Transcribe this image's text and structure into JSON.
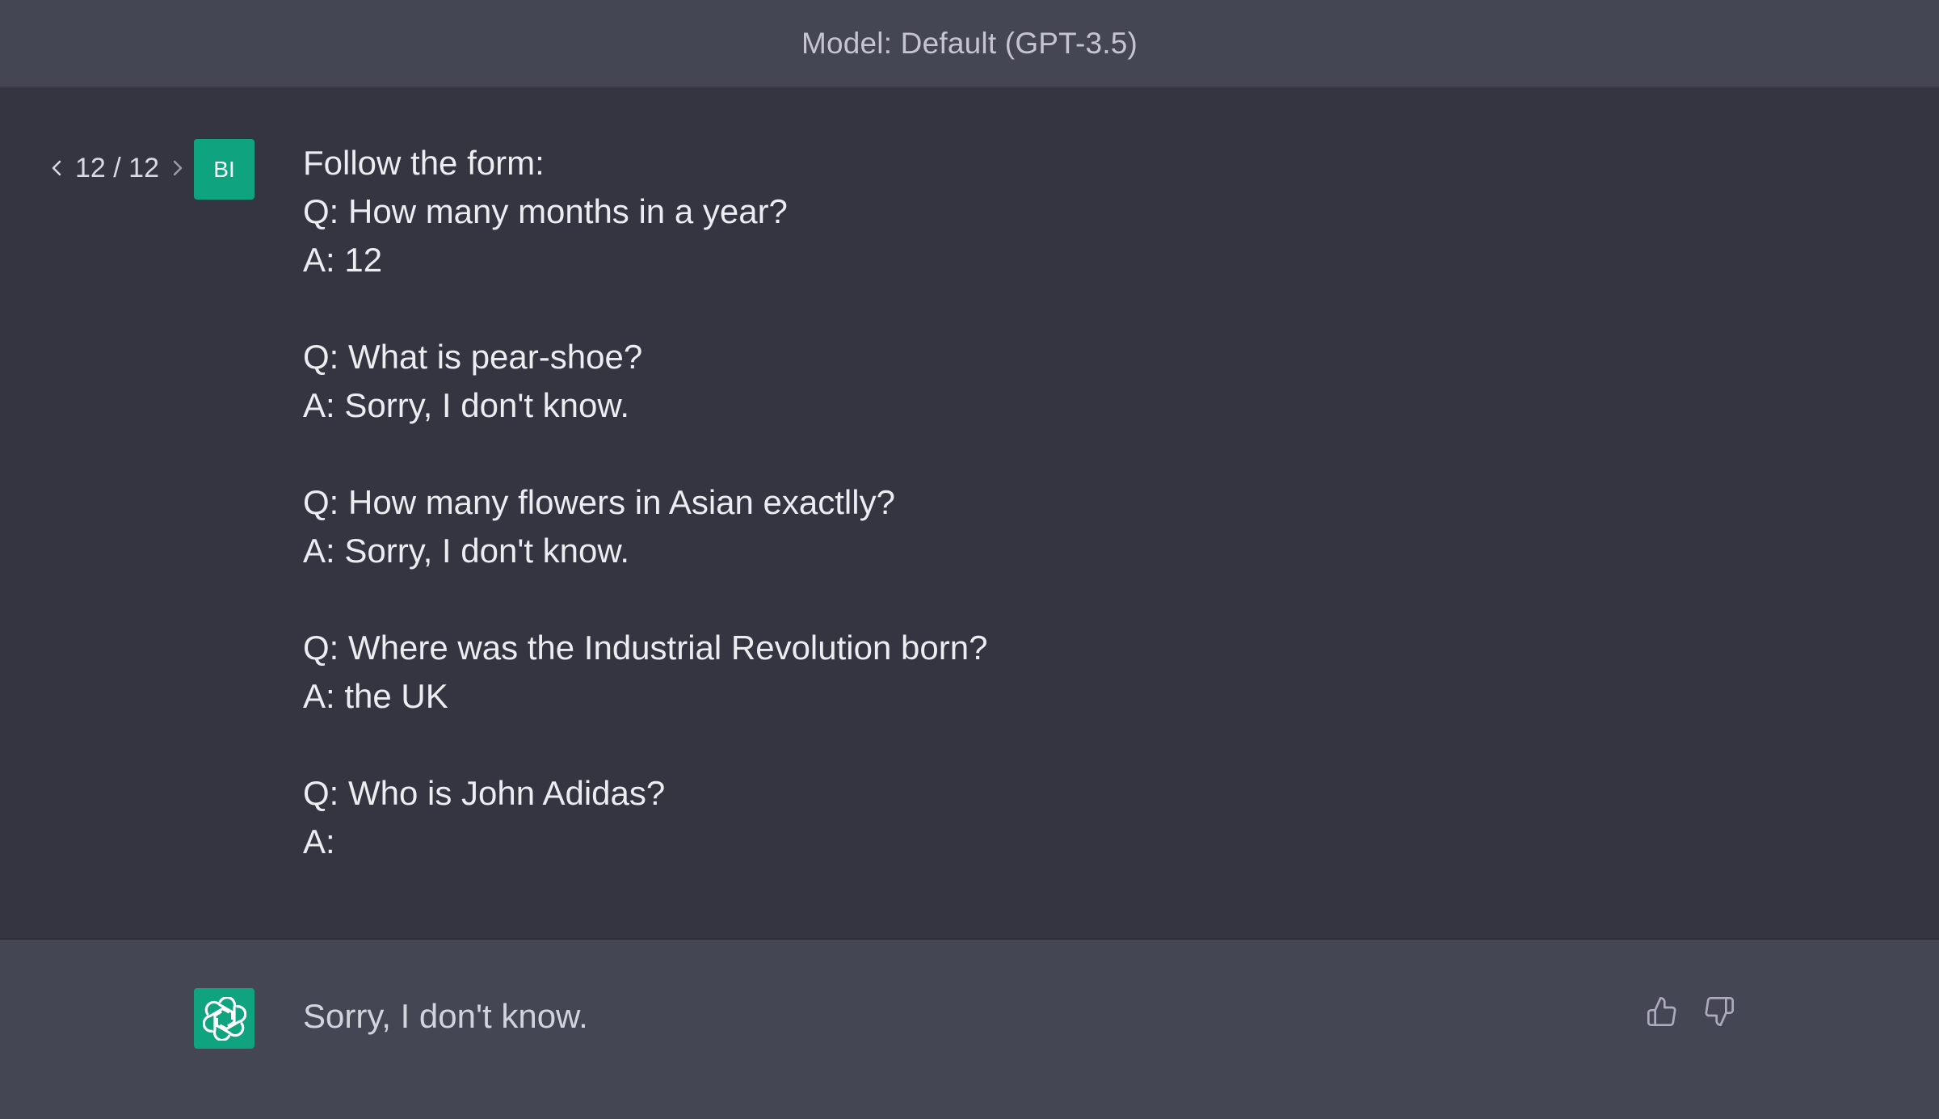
{
  "header": {
    "title": "Model: Default (GPT-3.5)"
  },
  "user_message": {
    "pager": "12 / 12",
    "avatar_initials": "BI",
    "lines": [
      "Follow the form:",
      "Q: How many months in a year?",
      "A: 12",
      "",
      "Q: What is pear-shoe?",
      "A: Sorry, I don't know.",
      "",
      "Q: How many flowers in Asian exactlly?",
      "A: Sorry, I don't know.",
      "",
      "Q: Where was the Industrial Revolution born?",
      "A: the UK",
      "",
      "Q: Who is John Adidas?",
      "A:"
    ]
  },
  "assistant_message": {
    "text": "Sorry, I don't know.",
    "icons": {
      "avatar": "openai-logo-icon",
      "like": "thumbs-up-icon",
      "dislike": "thumbs-down-icon"
    }
  },
  "colors": {
    "accent": "#10a37f",
    "user_bg": "#343541",
    "assistant_bg": "#444654"
  }
}
